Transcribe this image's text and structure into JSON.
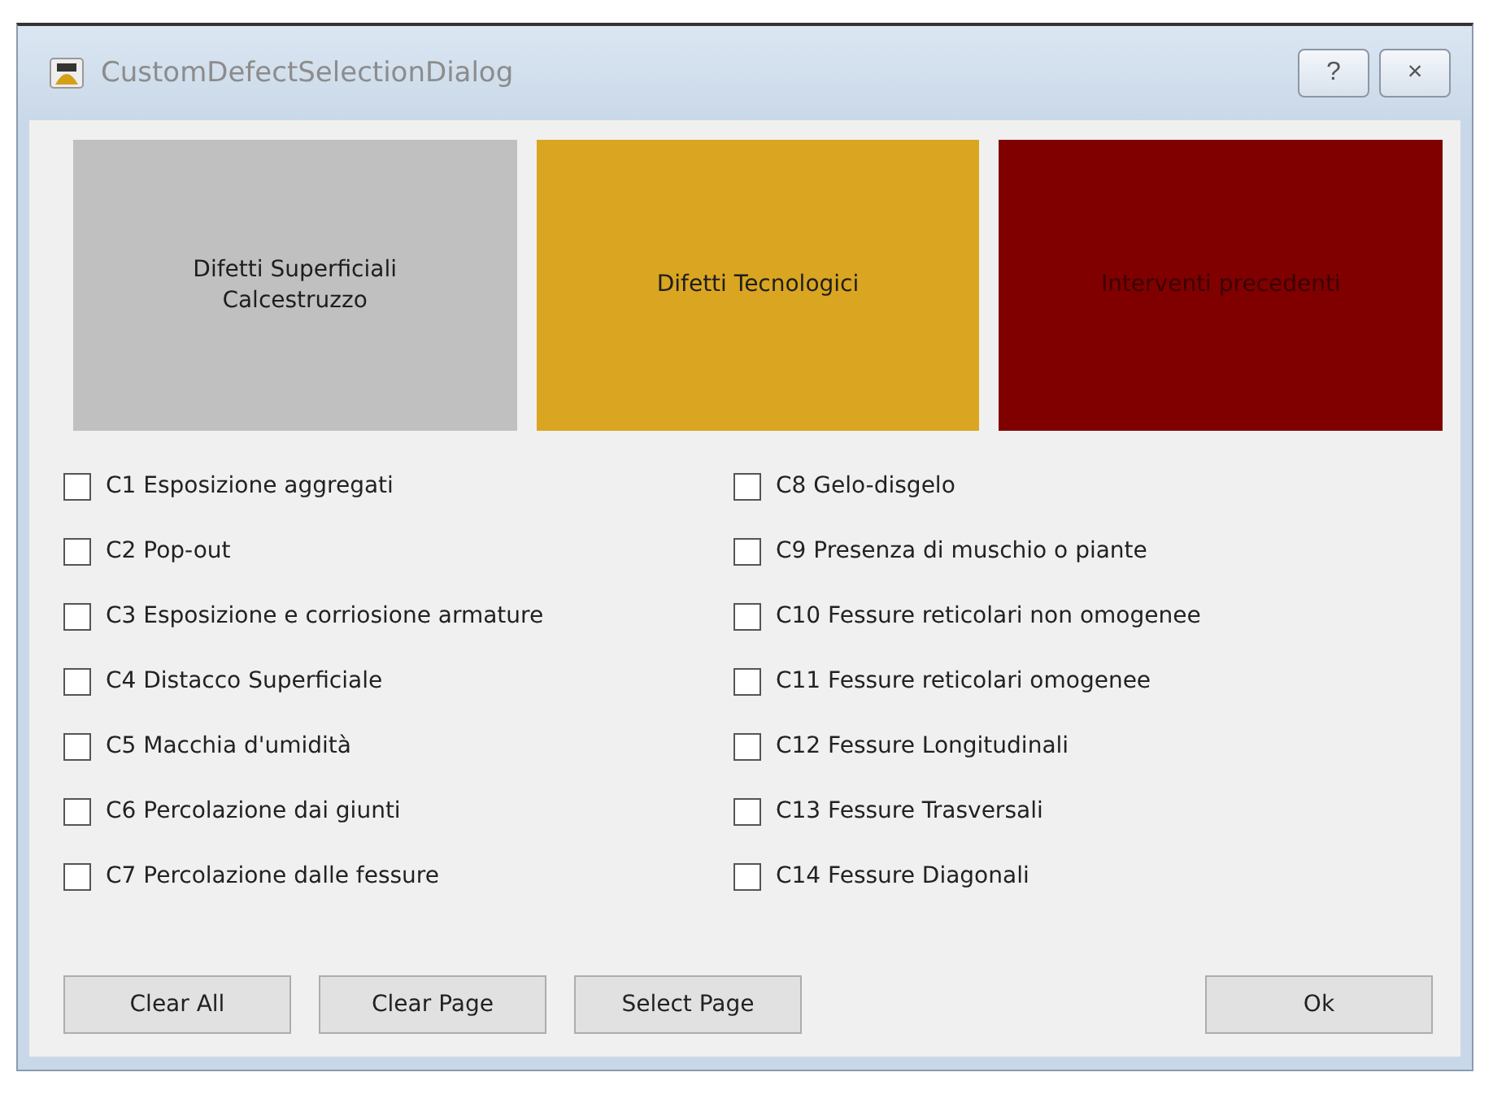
{
  "window": {
    "title": "CustomDefectSelectionDialog",
    "help_button": "?",
    "close_button": "×"
  },
  "categories": [
    {
      "label": "Difetti Superficiali\nCalcestruzzo",
      "color": "#c0c0c0"
    },
    {
      "label": "Difetti Tecnologici",
      "color": "#daa520"
    },
    {
      "label": "Interventi precedenti",
      "color": "#800000"
    }
  ],
  "defects": [
    {
      "label": "C1 Esposizione aggregati",
      "checked": false
    },
    {
      "label": "C2 Pop-out",
      "checked": false
    },
    {
      "label": "C3 Esposizione e corriosione armature",
      "checked": false
    },
    {
      "label": "C4 Distacco Superficiale",
      "checked": false
    },
    {
      "label": "C5 Macchia d'umidità",
      "checked": false
    },
    {
      "label": "C6 Percolazione dai giunti",
      "checked": false
    },
    {
      "label": "C7 Percolazione dalle fessure",
      "checked": false
    },
    {
      "label": "C8 Gelo-disgelo",
      "checked": false
    },
    {
      "label": "C9 Presenza di muschio o piante",
      "checked": false
    },
    {
      "label": "C10 Fessure reticolari non omogenee",
      "checked": false
    },
    {
      "label": "C11 Fessure reticolari omogenee",
      "checked": false
    },
    {
      "label": "C12 Fessure Longitudinali",
      "checked": false
    },
    {
      "label": "C13 Fessure Trasversali",
      "checked": false
    },
    {
      "label": "C14 Fessure Diagonali",
      "checked": false
    }
  ],
  "buttons": {
    "left": [
      "Clear All",
      "Clear Page",
      "Select Page"
    ],
    "right": [
      "Ok"
    ]
  }
}
